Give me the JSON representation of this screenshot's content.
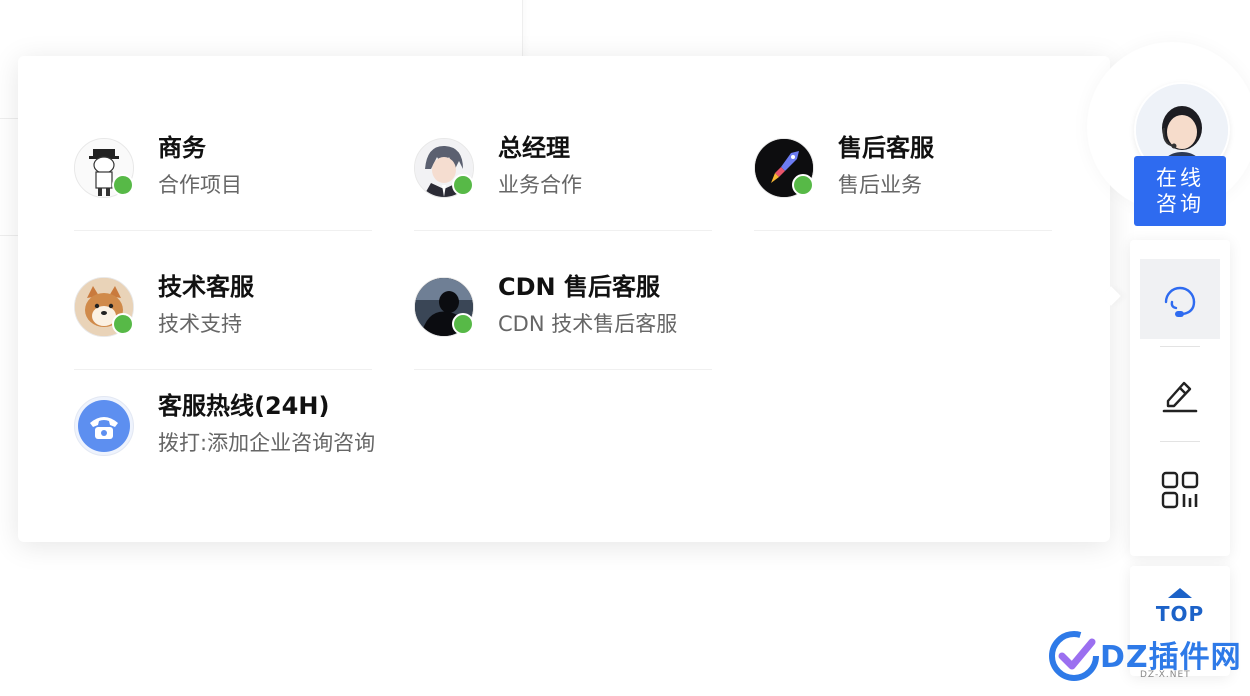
{
  "contacts": [
    {
      "name": "商务",
      "desc": "合作项目",
      "avatar": "cartoon-boy-avatar"
    },
    {
      "name": "总经理",
      "desc": "业务合作",
      "avatar": "anime-boy-avatar"
    },
    {
      "name": "售后客服",
      "desc": "售后业务",
      "avatar": "rocket-avatar"
    },
    {
      "name": "技术客服",
      "desc": "技术支持",
      "avatar": "shiba-dog-avatar"
    },
    {
      "name": "CDN 售后客服",
      "desc": "CDN 技术售后客服",
      "avatar": "silhouette-avatar"
    },
    {
      "name": "客服热线(24H)",
      "desc": "拨打:添加企业咨询咨询",
      "avatar": "phone-icon"
    }
  ],
  "sidebar": {
    "consult_line1": "在线",
    "consult_line2": "咨询",
    "tools": [
      "headset-icon",
      "edit-icon",
      "qrcode-icon"
    ],
    "top_label": "TOP"
  },
  "watermark": {
    "main": "DZ插件网",
    "sub": "DZ-X.NET"
  },
  "colors": {
    "accent": "#2e6bf0",
    "online": "#57b947",
    "top": "#1c62c8"
  }
}
